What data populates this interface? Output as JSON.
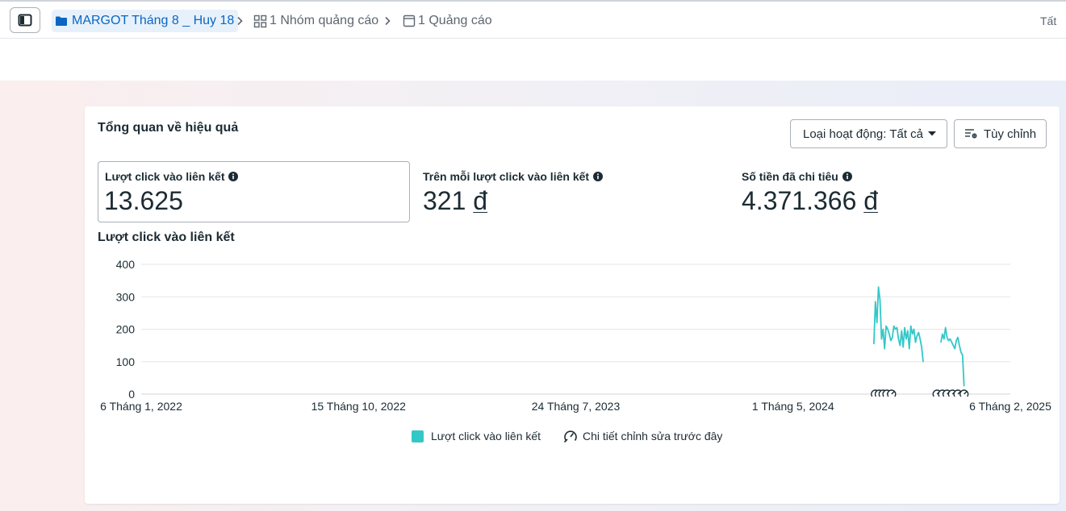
{
  "breadcrumb": {
    "campaign": "MARGOT Tháng 8 _ Huy 18",
    "ad_set": "1 Nhóm quảng cáo",
    "ad": "1 Quảng cáo"
  },
  "top_right_text": "Tất",
  "card": {
    "title": "Tổng quan về hiệu quả",
    "activity_dropdown": "Loại hoạt động: Tất cả",
    "customize_button": "Tùy chỉnh"
  },
  "metrics": [
    {
      "label": "Lượt click vào liên kết",
      "value": "13.625",
      "currency": ""
    },
    {
      "label": "Trên mỗi lượt click vào liên kết",
      "value": "321",
      "currency": "đ"
    },
    {
      "label": "Số tiền đã chi tiêu",
      "value": "4.371.366",
      "currency": "đ"
    }
  ],
  "chart_title": "Lượt click vào liên kết",
  "legend": {
    "series": "Lượt click vào liên kết",
    "edits": "Chi tiết chỉnh sửa trước đây"
  },
  "colors": {
    "accent": "#0a66c2",
    "series": "#33c7c7",
    "breadcrumb_bg": "#e7f1fb"
  },
  "icons": {
    "sidebar": "sidebar-toggle-icon",
    "folder": "folder-icon",
    "grid": "grid-icon",
    "ad": "ad-icon",
    "chevron": "chevron-right-icon",
    "info": "info-icon",
    "caret": "caret-down-icon",
    "settings": "customize-icon",
    "gauge": "gauge-icon"
  },
  "chart_data": {
    "type": "line",
    "title": "Lượt click vào liên kết",
    "xlabel": "",
    "ylabel": "",
    "ylim": [
      0,
      400
    ],
    "yticks": [
      0,
      100,
      200,
      300,
      400
    ],
    "x_tick_labels": [
      "6 Tháng 1, 2022",
      "15 Tháng 10, 2022",
      "24 Tháng 7, 2023",
      "1 Tháng 5, 2024",
      "6 Tháng 2, 2025"
    ],
    "xlim": [
      "2022-01-06",
      "2025-02-06"
    ],
    "grid": true,
    "legend_position": "bottom-center",
    "series": [
      {
        "name": "Lượt click vào liên kết",
        "color": "#33c7c7",
        "segments": [
          {
            "x": [
              "2024-08-13",
              "2024-08-15",
              "2024-08-17",
              "2024-08-19",
              "2024-08-21",
              "2024-08-23",
              "2024-08-25",
              "2024-08-27",
              "2024-08-29",
              "2024-08-31",
              "2024-09-02",
              "2024-09-04",
              "2024-09-06",
              "2024-09-08",
              "2024-09-10",
              "2024-09-12",
              "2024-09-14",
              "2024-09-16",
              "2024-09-18",
              "2024-09-20",
              "2024-09-22",
              "2024-09-24",
              "2024-09-26",
              "2024-09-28",
              "2024-09-30",
              "2024-10-02",
              "2024-10-04",
              "2024-10-06",
              "2024-10-08",
              "2024-10-10",
              "2024-10-12",
              "2024-10-14",
              "2024-10-16"
            ],
            "y": [
              155,
              285,
              220,
              330,
              290,
              170,
              200,
              140,
              210,
              200,
              185,
              165,
              175,
              210,
              200,
              205,
              170,
              150,
              195,
              145,
              205,
              170,
              195,
              140,
              210,
              185,
              200,
              160,
              180,
              190,
              170,
              145,
              100
            ]
          },
          {
            "x": [
              "2024-11-08",
              "2024-11-10",
              "2024-11-12",
              "2024-11-14",
              "2024-11-16",
              "2024-11-18",
              "2024-11-20",
              "2024-11-22",
              "2024-11-24",
              "2024-11-26",
              "2024-11-28",
              "2024-11-30",
              "2024-12-02",
              "2024-12-04",
              "2024-12-06",
              "2024-12-08"
            ],
            "y": [
              160,
              185,
              170,
              205,
              175,
              165,
              170,
              160,
              150,
              140,
              165,
              175,
              150,
              130,
              120,
              25
            ]
          }
        ]
      }
    ],
    "annotations": [
      {
        "type": "edit-markers",
        "x": [
          "2024-08-15",
          "2024-08-20",
          "2024-08-25",
          "2024-08-30",
          "2024-09-05"
        ]
      },
      {
        "type": "edit-markers",
        "x": [
          "2024-11-03",
          "2024-11-10",
          "2024-11-16",
          "2024-11-23",
          "2024-11-30",
          "2024-12-08"
        ]
      }
    ]
  }
}
